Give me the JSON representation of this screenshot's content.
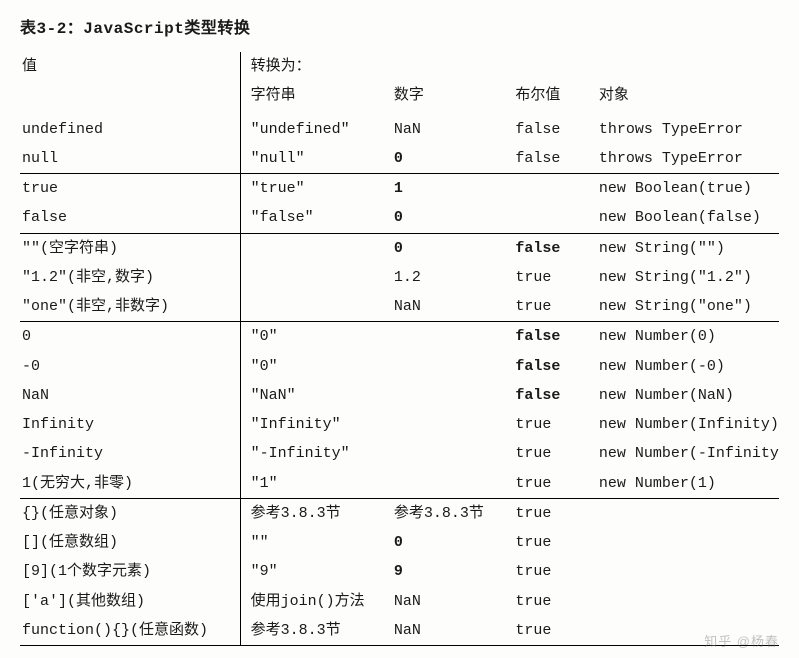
{
  "title": "表3-2：JavaScript类型转换",
  "header": {
    "value": "值",
    "convert_to": "转换为：",
    "string": "字符串",
    "number": "数字",
    "boolean": "布尔值",
    "object": "对象"
  },
  "sections": [
    {
      "rows": [
        {
          "value": "undefined",
          "string": "\"undefined\"",
          "number": "NaN",
          "boolean": "false",
          "object": "throws TypeError"
        },
        {
          "value": "null",
          "string": "\"null\"",
          "number": "0",
          "number_bold": true,
          "boolean": "false",
          "object": "throws TypeError"
        }
      ]
    },
    {
      "rows": [
        {
          "value": "true",
          "string": "\"true\"",
          "number": "1",
          "number_bold": true,
          "boolean": "",
          "object": "new Boolean(true)"
        },
        {
          "value": "false",
          "string": "\"false\"",
          "number": "0",
          "number_bold": true,
          "boolean": "",
          "object": "new Boolean(false)"
        }
      ]
    },
    {
      "rows": [
        {
          "value": "\"\"(空字符串)",
          "string": "",
          "number": "0",
          "number_bold": true,
          "boolean": "false",
          "boolean_bold": true,
          "object": "new String(\"\")"
        },
        {
          "value": "\"1.2\"(非空,数字)",
          "string": "",
          "number": "1.2",
          "boolean": "true",
          "object": "new String(\"1.2\")"
        },
        {
          "value": "\"one\"(非空,非数字)",
          "string": "",
          "number": "NaN",
          "boolean": "true",
          "object": "new String(\"one\")"
        }
      ]
    },
    {
      "rows": [
        {
          "value": "0",
          "string": "\"0\"",
          "number": "",
          "boolean": "false",
          "boolean_bold": true,
          "object": "new Number(0)"
        },
        {
          "value": "-0",
          "string": "\"0\"",
          "number": "",
          "boolean": "false",
          "boolean_bold": true,
          "object": "new Number(-0)"
        },
        {
          "value": "NaN",
          "string": "\"NaN\"",
          "number": "",
          "boolean": "false",
          "boolean_bold": true,
          "object": "new Number(NaN)"
        },
        {
          "value": "Infinity",
          "string": "\"Infinity\"",
          "number": "",
          "boolean": "true",
          "object": "new Number(Infinity)"
        },
        {
          "value": "-Infinity",
          "string": "\"-Infinity\"",
          "number": "",
          "boolean": "true",
          "object": "new Number(-Infinity)"
        },
        {
          "value": "1(无穷大,非零)",
          "string": "\"1\"",
          "number": "",
          "boolean": "true",
          "object": "new Number(1)"
        }
      ]
    },
    {
      "rows": [
        {
          "value": "{}(任意对象)",
          "string": "参考3.8.3节",
          "string_cn": true,
          "number": "参考3.8.3节",
          "number_cn": true,
          "boolean": "true",
          "object": ""
        },
        {
          "value": "[](任意数组)",
          "string": "\"\"",
          "number": "0",
          "number_bold": true,
          "boolean": "true",
          "object": ""
        },
        {
          "value": "[9](1个数字元素)",
          "string": "\"9\"",
          "number": "9",
          "number_bold": true,
          "boolean": "true",
          "object": ""
        },
        {
          "value": "['a'](其他数组)",
          "string": "使用join()方法",
          "string_cn": true,
          "number": "NaN",
          "boolean": "true",
          "object": ""
        },
        {
          "value": "function(){}(任意函数)",
          "string": "参考3.8.3节",
          "string_cn": true,
          "number": "NaN",
          "boolean": "true",
          "object": ""
        }
      ]
    }
  ],
  "watermark": "知乎 @杨春"
}
